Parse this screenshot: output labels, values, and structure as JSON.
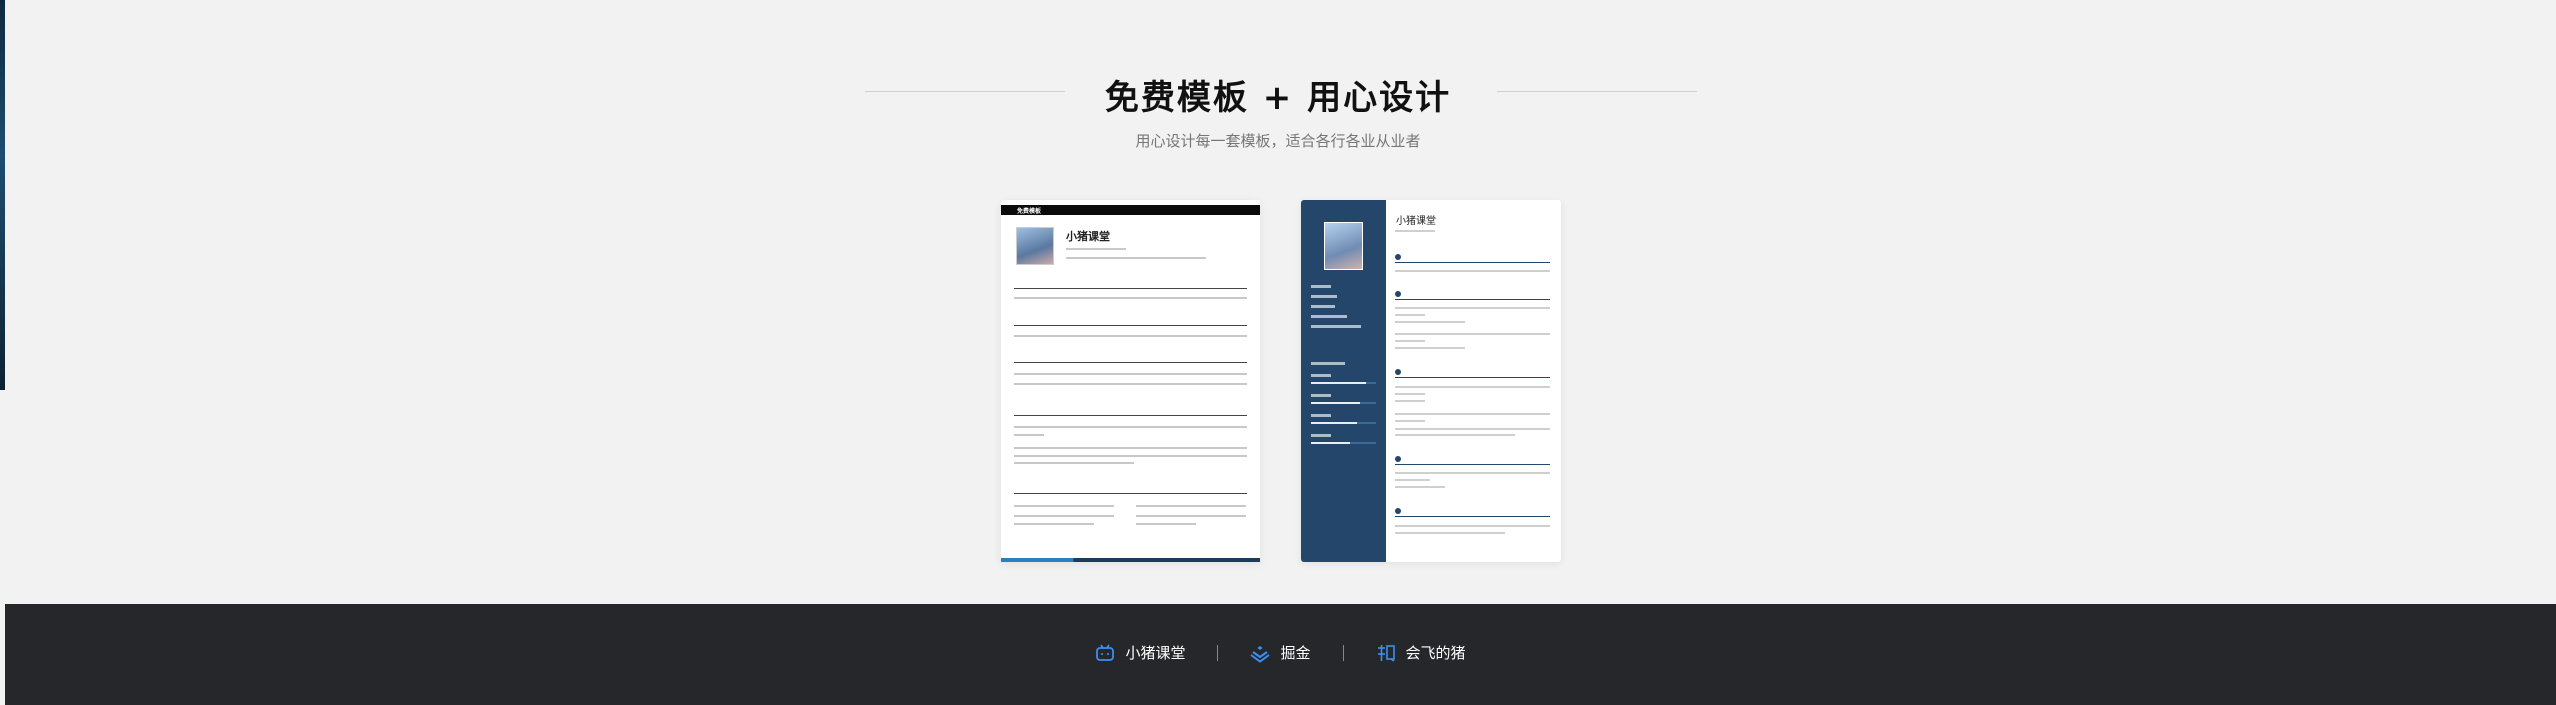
{
  "section": {
    "title": "免费模板 + 用心设计",
    "subtitle": "用心设计每一套模板，适合各行各业从业者"
  },
  "templates": [
    {
      "name": "小猪课堂",
      "tag": "免费模板"
    },
    {
      "name": "小猪课堂"
    }
  ],
  "footer": {
    "links": [
      {
        "label": "小猪课堂",
        "icon": "bilibili-icon"
      },
      {
        "label": "掘金",
        "icon": "juejin-icon"
      },
      {
        "label": "会飞的猪",
        "icon": "zhihu-icon"
      }
    ]
  },
  "colors": {
    "accent": "#3d8ff2",
    "footer_bg": "#26272b",
    "resume_sidebar": "#24466a"
  }
}
